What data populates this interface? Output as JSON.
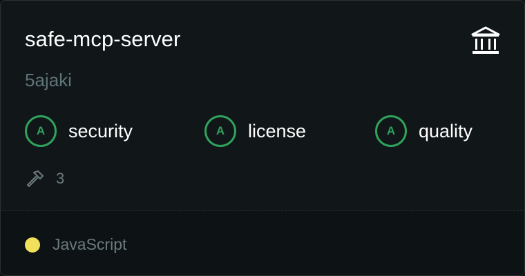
{
  "repo": {
    "name": "safe-mcp-server",
    "owner": "5ajaki"
  },
  "icons": {
    "badge": "institution-icon",
    "tools": "hammer-icon"
  },
  "grades": [
    {
      "grade": "A",
      "label": "security"
    },
    {
      "grade": "A",
      "label": "license"
    },
    {
      "grade": "A",
      "label": "quality"
    }
  ],
  "tools": {
    "count": "3"
  },
  "language": {
    "name": "JavaScript",
    "color": "#f1e05a"
  },
  "colors": {
    "grade_green": "#2fa35d",
    "background": "#111618",
    "muted_text": "#6b7a7d"
  }
}
